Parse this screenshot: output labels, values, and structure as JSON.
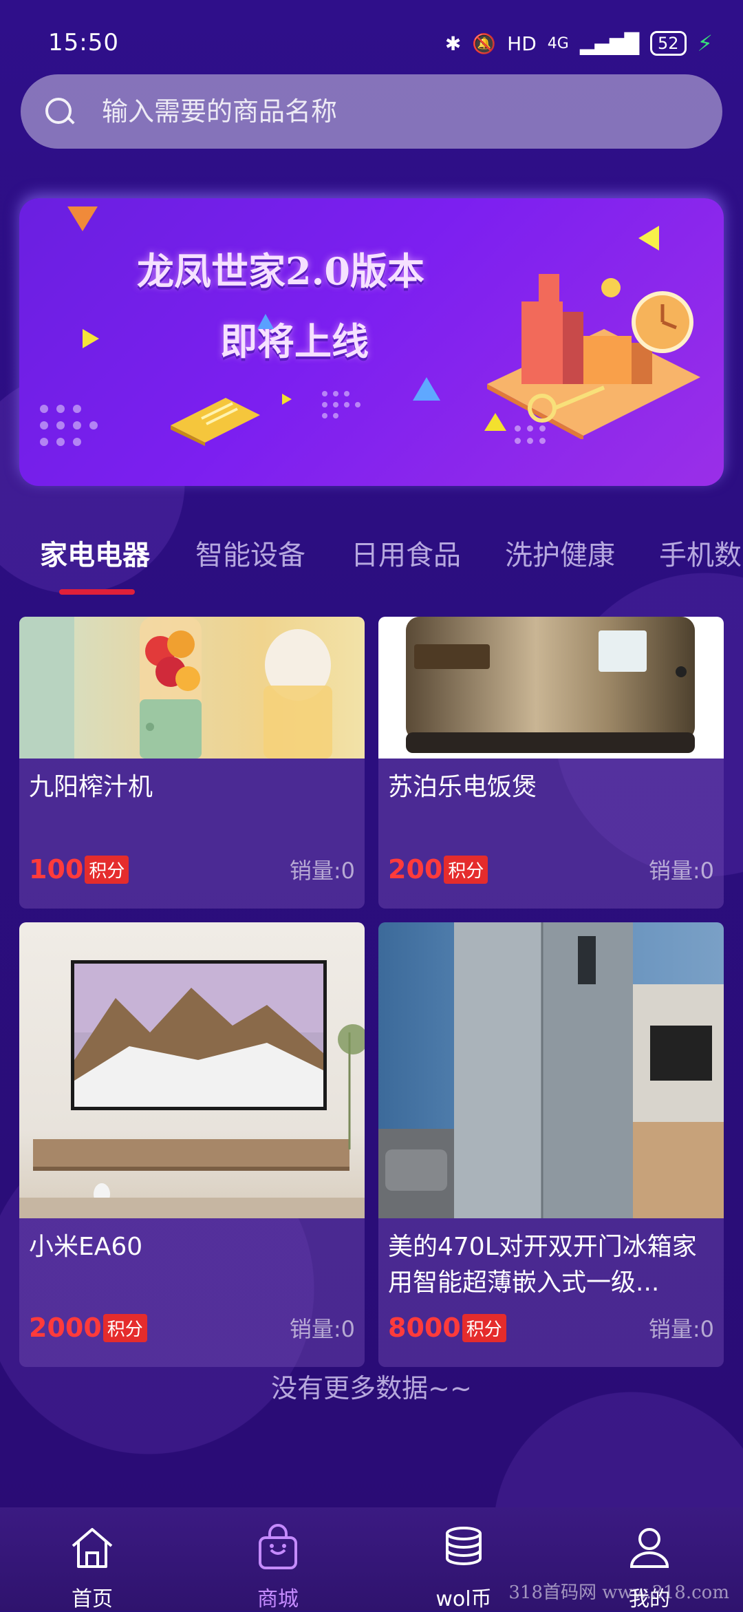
{
  "status_bar": {
    "time": "15:50",
    "bluetooth": "bluetooth-icon",
    "mute": "mute-icon",
    "hd": "HD",
    "network": "4G",
    "battery": "52"
  },
  "search": {
    "placeholder": "输入需要的商品名称"
  },
  "banner": {
    "line1": "龙凤世家2.0版本",
    "line2": "即将上线"
  },
  "tabs": [
    "家电电器",
    "智能设备",
    "日用食品",
    "洗护健康",
    "手机数"
  ],
  "products": [
    {
      "name": "九阳榨汁机",
      "price": "100",
      "unit": "积分",
      "sales": "销量:0"
    },
    {
      "name": "苏泊乐电饭煲",
      "price": "200",
      "unit": "积分",
      "sales": "销量:0"
    },
    {
      "name": "小米EA60",
      "price": "2000",
      "unit": "积分",
      "sales": "销量:0"
    },
    {
      "name": "美的470L对开双开门冰箱家用智能超薄嵌入式一级...",
      "price": "8000",
      "unit": "积分",
      "sales": "销量:0"
    }
  ],
  "no_more": "没有更多数据~~",
  "bottom_nav": [
    {
      "label": "首页",
      "icon": "home-icon"
    },
    {
      "label": "商城",
      "icon": "shopping-bag-icon"
    },
    {
      "label": "wol币",
      "icon": "coins-icon"
    },
    {
      "label": "我的",
      "icon": "user-icon"
    }
  ],
  "watermark": "318首码网 www.318.com",
  "colors": {
    "accent": "#e0203a",
    "price": "#ff3b3b",
    "nav_active": "#c58bff"
  }
}
